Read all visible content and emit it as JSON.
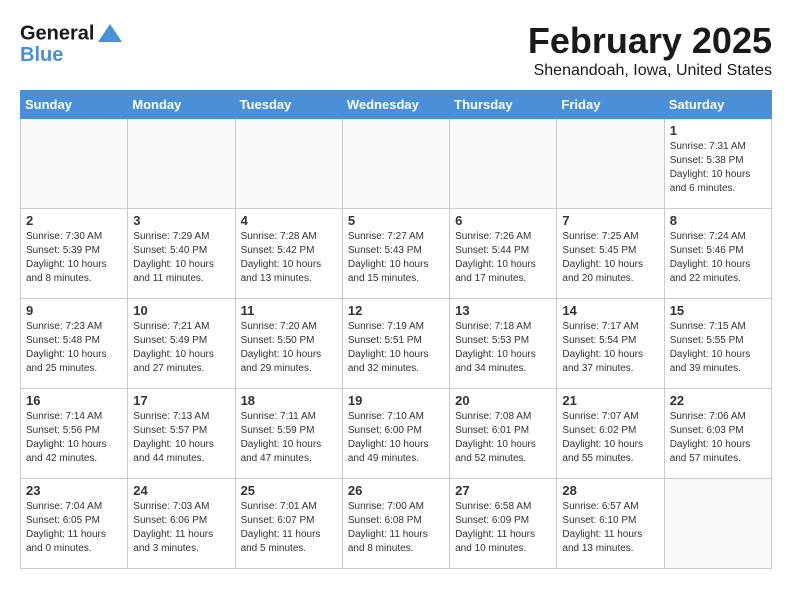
{
  "header": {
    "logo_line1": "General",
    "logo_line2": "Blue",
    "month_title": "February 2025",
    "location": "Shenandoah, Iowa, United States"
  },
  "weekdays": [
    "Sunday",
    "Monday",
    "Tuesday",
    "Wednesday",
    "Thursday",
    "Friday",
    "Saturday"
  ],
  "weeks": [
    [
      {
        "day": "",
        "info": ""
      },
      {
        "day": "",
        "info": ""
      },
      {
        "day": "",
        "info": ""
      },
      {
        "day": "",
        "info": ""
      },
      {
        "day": "",
        "info": ""
      },
      {
        "day": "",
        "info": ""
      },
      {
        "day": "1",
        "info": "Sunrise: 7:31 AM\nSunset: 5:38 PM\nDaylight: 10 hours\nand 6 minutes."
      }
    ],
    [
      {
        "day": "2",
        "info": "Sunrise: 7:30 AM\nSunset: 5:39 PM\nDaylight: 10 hours\nand 8 minutes."
      },
      {
        "day": "3",
        "info": "Sunrise: 7:29 AM\nSunset: 5:40 PM\nDaylight: 10 hours\nand 11 minutes."
      },
      {
        "day": "4",
        "info": "Sunrise: 7:28 AM\nSunset: 5:42 PM\nDaylight: 10 hours\nand 13 minutes."
      },
      {
        "day": "5",
        "info": "Sunrise: 7:27 AM\nSunset: 5:43 PM\nDaylight: 10 hours\nand 15 minutes."
      },
      {
        "day": "6",
        "info": "Sunrise: 7:26 AM\nSunset: 5:44 PM\nDaylight: 10 hours\nand 17 minutes."
      },
      {
        "day": "7",
        "info": "Sunrise: 7:25 AM\nSunset: 5:45 PM\nDaylight: 10 hours\nand 20 minutes."
      },
      {
        "day": "8",
        "info": "Sunrise: 7:24 AM\nSunset: 5:46 PM\nDaylight: 10 hours\nand 22 minutes."
      }
    ],
    [
      {
        "day": "9",
        "info": "Sunrise: 7:23 AM\nSunset: 5:48 PM\nDaylight: 10 hours\nand 25 minutes."
      },
      {
        "day": "10",
        "info": "Sunrise: 7:21 AM\nSunset: 5:49 PM\nDaylight: 10 hours\nand 27 minutes."
      },
      {
        "day": "11",
        "info": "Sunrise: 7:20 AM\nSunset: 5:50 PM\nDaylight: 10 hours\nand 29 minutes."
      },
      {
        "day": "12",
        "info": "Sunrise: 7:19 AM\nSunset: 5:51 PM\nDaylight: 10 hours\nand 32 minutes."
      },
      {
        "day": "13",
        "info": "Sunrise: 7:18 AM\nSunset: 5:53 PM\nDaylight: 10 hours\nand 34 minutes."
      },
      {
        "day": "14",
        "info": "Sunrise: 7:17 AM\nSunset: 5:54 PM\nDaylight: 10 hours\nand 37 minutes."
      },
      {
        "day": "15",
        "info": "Sunrise: 7:15 AM\nSunset: 5:55 PM\nDaylight: 10 hours\nand 39 minutes."
      }
    ],
    [
      {
        "day": "16",
        "info": "Sunrise: 7:14 AM\nSunset: 5:56 PM\nDaylight: 10 hours\nand 42 minutes."
      },
      {
        "day": "17",
        "info": "Sunrise: 7:13 AM\nSunset: 5:57 PM\nDaylight: 10 hours\nand 44 minutes."
      },
      {
        "day": "18",
        "info": "Sunrise: 7:11 AM\nSunset: 5:59 PM\nDaylight: 10 hours\nand 47 minutes."
      },
      {
        "day": "19",
        "info": "Sunrise: 7:10 AM\nSunset: 6:00 PM\nDaylight: 10 hours\nand 49 minutes."
      },
      {
        "day": "20",
        "info": "Sunrise: 7:08 AM\nSunset: 6:01 PM\nDaylight: 10 hours\nand 52 minutes."
      },
      {
        "day": "21",
        "info": "Sunrise: 7:07 AM\nSunset: 6:02 PM\nDaylight: 10 hours\nand 55 minutes."
      },
      {
        "day": "22",
        "info": "Sunrise: 7:06 AM\nSunset: 6:03 PM\nDaylight: 10 hours\nand 57 minutes."
      }
    ],
    [
      {
        "day": "23",
        "info": "Sunrise: 7:04 AM\nSunset: 6:05 PM\nDaylight: 11 hours\nand 0 minutes."
      },
      {
        "day": "24",
        "info": "Sunrise: 7:03 AM\nSunset: 6:06 PM\nDaylight: 11 hours\nand 3 minutes."
      },
      {
        "day": "25",
        "info": "Sunrise: 7:01 AM\nSunset: 6:07 PM\nDaylight: 11 hours\nand 5 minutes."
      },
      {
        "day": "26",
        "info": "Sunrise: 7:00 AM\nSunset: 6:08 PM\nDaylight: 11 hours\nand 8 minutes."
      },
      {
        "day": "27",
        "info": "Sunrise: 6:58 AM\nSunset: 6:09 PM\nDaylight: 11 hours\nand 10 minutes."
      },
      {
        "day": "28",
        "info": "Sunrise: 6:57 AM\nSunset: 6:10 PM\nDaylight: 11 hours\nand 13 minutes."
      },
      {
        "day": "",
        "info": ""
      }
    ]
  ]
}
